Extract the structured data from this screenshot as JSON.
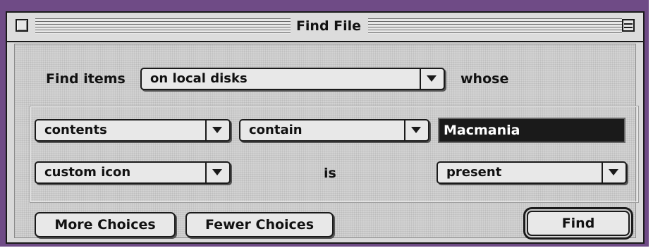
{
  "window": {
    "title": "Find File"
  },
  "find_row": {
    "label_prefix": "Find items",
    "location_value": "on local disks",
    "label_suffix": "whose"
  },
  "criteria": [
    {
      "attribute": "contents",
      "operator": "contain",
      "value": "Macmania"
    },
    {
      "attribute": "custom icon",
      "operator": "is",
      "value": "present"
    }
  ],
  "buttons": {
    "more_choices": "More Choices",
    "fewer_choices": "Fewer Choices",
    "find": "Find"
  },
  "colors": {
    "frame_purple": "#6f4b86",
    "window_gray": "#d2d2d2",
    "selected_field_bg": "#1a1a1a"
  }
}
